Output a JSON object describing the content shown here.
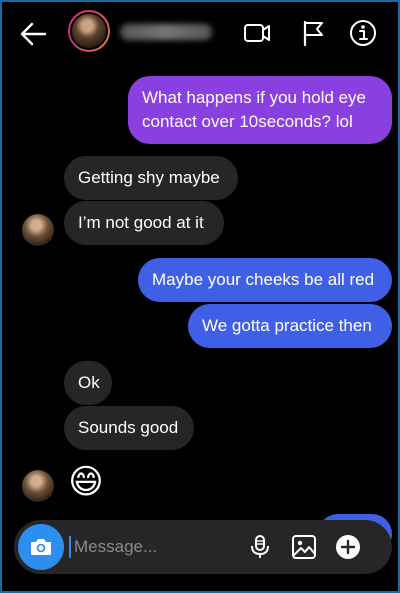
{
  "header": {
    "username": "shaydriigh",
    "icons": {
      "back": "back-arrow-icon",
      "video": "video-call-icon",
      "flag": "flag-icon",
      "info": "info-icon"
    }
  },
  "messages": [
    {
      "direction": "sent",
      "text": "What happens if you hold eye contact over 10seconds? lol",
      "color": "#8a3fe0"
    },
    {
      "direction": "received",
      "text": "Getting shy maybe"
    },
    {
      "direction": "received",
      "text": "I’m not good at it"
    },
    {
      "direction": "sent",
      "text": "Maybe your cheeks be all red",
      "color": "#3f60e6"
    },
    {
      "direction": "sent",
      "text": "We gotta practice then",
      "color": "#3f60e6"
    },
    {
      "direction": "received",
      "text": "Ok"
    },
    {
      "direction": "received",
      "text": "Sounds good"
    },
    {
      "direction": "received",
      "text": "😄"
    }
  ],
  "composer": {
    "placeholder": "Message...",
    "icons": {
      "camera": "camera-icon",
      "mic": "microphone-icon",
      "gallery": "gallery-icon",
      "plus": "plus-icon"
    }
  },
  "colors": {
    "background": "#000000",
    "received_bubble": "#262626",
    "sent_purple": "#8a3fe0",
    "sent_blue": "#3f60e6",
    "camera_button": "#2b8ef0",
    "frame_border": "#1a6aa0"
  }
}
